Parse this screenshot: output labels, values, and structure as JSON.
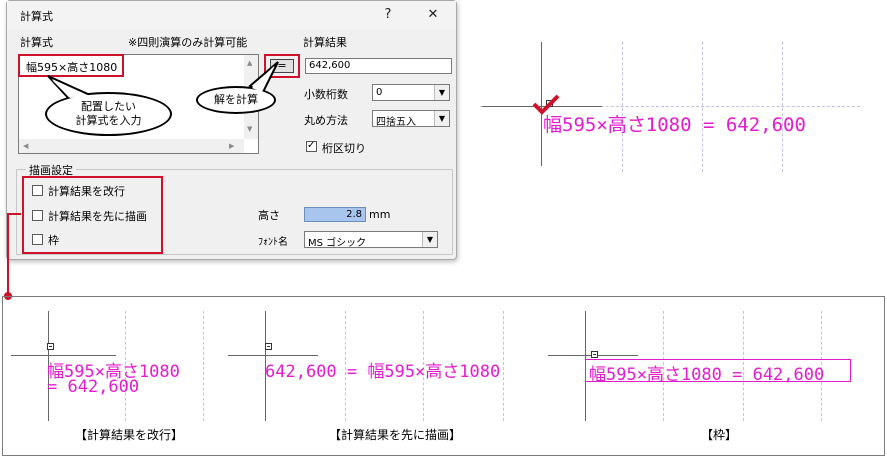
{
  "dialog": {
    "title": "計算式",
    "help_btn": "?",
    "close_btn": "✕",
    "formula_label": "計算式",
    "note": "※四則演算のみ計算可能",
    "formula_value": "幅595×高さ1080",
    "calc_button": "=",
    "result_label": "計算結果",
    "result_value": "642,600",
    "decimal_label": "小数桁数",
    "decimal_value": "0",
    "rounding_label": "丸め方法",
    "rounding_value": "四捨五入",
    "digit_sep_label": "桁区切り",
    "draw_group": "描画設定",
    "opt_newline": "計算結果を改行",
    "opt_first": "計算結果を先に描画",
    "opt_frame": "枠",
    "height_label": "高さ",
    "height_value": "2.8",
    "height_unit": "mm",
    "font_label": "ﾌｫﾝﾄ名",
    "font_value": "MS ゴシック"
  },
  "callouts": {
    "input": "配置したい\n計算式を入力",
    "calc": "解を計算"
  },
  "preview": {
    "main_text": "幅595×高さ1080 = 642,600"
  },
  "examples": [
    {
      "line1": "幅595×高さ1080",
      "line2": "= 642,600",
      "caption": "【計算結果を改行】"
    },
    {
      "line1": "642,600 = 幅595×高さ1080",
      "caption": "【計算結果を先に描画】"
    },
    {
      "line1": "幅595×高さ1080 = 642,600",
      "caption": "【枠】"
    }
  ],
  "colors": {
    "accent_red": "#d0112b",
    "text_magenta": "#e51bd0"
  }
}
